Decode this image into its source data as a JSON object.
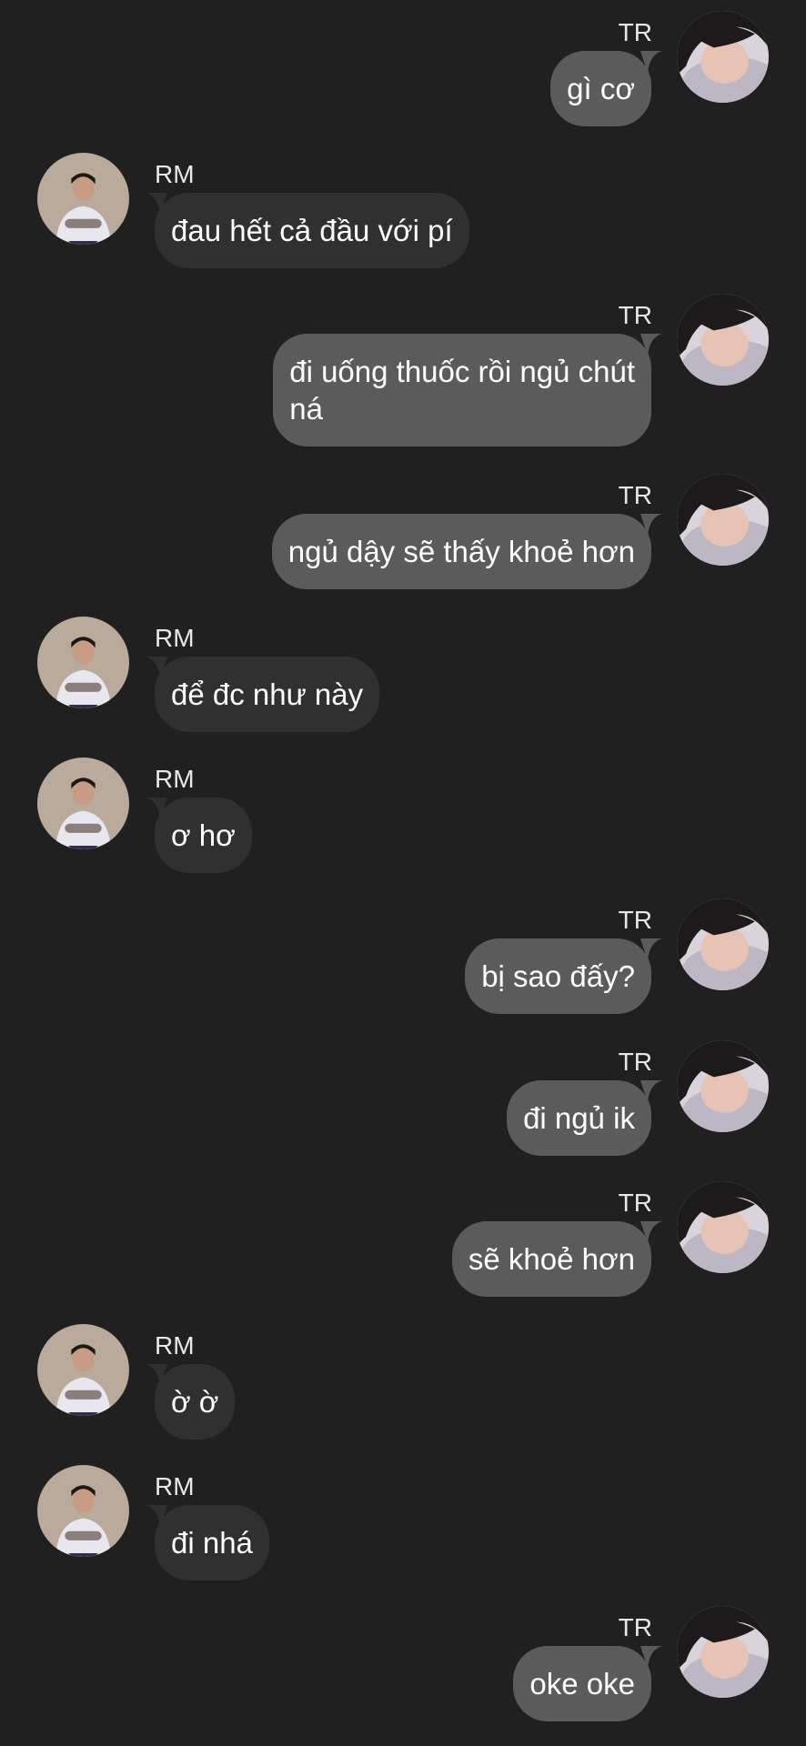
{
  "contacts": {
    "me": {
      "name": "TR",
      "avatar_icon": "avatar-tr-photo-icon",
      "bubble_color": "#5b5b5c"
    },
    "other": {
      "name": "RM",
      "avatar_icon": "avatar-rm-photo-icon",
      "bubble_color": "#303031"
    }
  },
  "background_color": "#202021",
  "messages": [
    {
      "sender": "TR",
      "text": "gì cơ"
    },
    {
      "sender": "RM",
      "text": "đau hết cả đầu với pí"
    },
    {
      "sender": "TR",
      "text": "đi uống thuốc rồi ngủ chút\nná"
    },
    {
      "sender": "TR",
      "text": "ngủ dậy sẽ thấy khoẻ hơn"
    },
    {
      "sender": "RM",
      "text": "để đc như này"
    },
    {
      "sender": "RM",
      "text": "ơ hơ"
    },
    {
      "sender": "TR",
      "text": "bị sao đấy?"
    },
    {
      "sender": "TR",
      "text": "đi ngủ ik"
    },
    {
      "sender": "TR",
      "text": "sẽ khoẻ hơn"
    },
    {
      "sender": "RM",
      "text": "ờ ờ"
    },
    {
      "sender": "RM",
      "text": "đi nhá"
    },
    {
      "sender": "TR",
      "text": "oke oke"
    }
  ]
}
